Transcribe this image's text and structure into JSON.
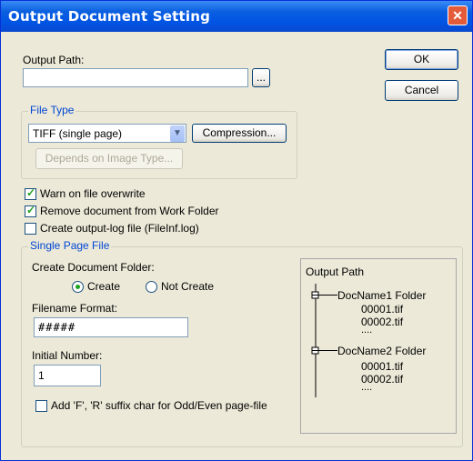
{
  "window": {
    "title": "Output Document Setting",
    "close_glyph": "✕"
  },
  "output_path": {
    "label": "Output Path:",
    "value": "",
    "browse_label": "..."
  },
  "buttons": {
    "ok": "OK",
    "cancel": "Cancel"
  },
  "file_type": {
    "legend": "File Type",
    "selected": "TIFF (single page)",
    "compression_label": "Compression...",
    "depends_label": "Depends on Image Type..."
  },
  "options": {
    "warn_overwrite": {
      "label": "Warn on file overwrite",
      "checked": true
    },
    "remove_document": {
      "label": "Remove document from Work Folder",
      "checked": true
    },
    "create_log": {
      "label": "Create output-log file (FileInf.log)",
      "checked": false
    }
  },
  "single_page": {
    "legend": "Single Page File",
    "create_folder_label": "Create Document Folder:",
    "radio_create": "Create",
    "radio_not_create": "Not Create",
    "selected": "Create",
    "filename_format_label": "Filename Format:",
    "filename_format_value": "#####",
    "initial_number_label": "Initial Number:",
    "initial_number_value": "1",
    "suffix_label": "Add 'F', 'R' suffix char for Odd/Even page-file",
    "suffix_checked": false
  },
  "preview": {
    "title": "Output Path",
    "folder1": "DocName1 Folder",
    "folder1_files": [
      "00001.tif",
      "00002.tif",
      "...."
    ],
    "folder2": "DocName2 Folder",
    "folder2_files": [
      "00001.tif",
      "00002.tif",
      "...."
    ]
  },
  "colors": {
    "title_bar": "#0054E3",
    "legend": "#0046D5",
    "check": "#21A121",
    "close": "#E45B3A"
  }
}
